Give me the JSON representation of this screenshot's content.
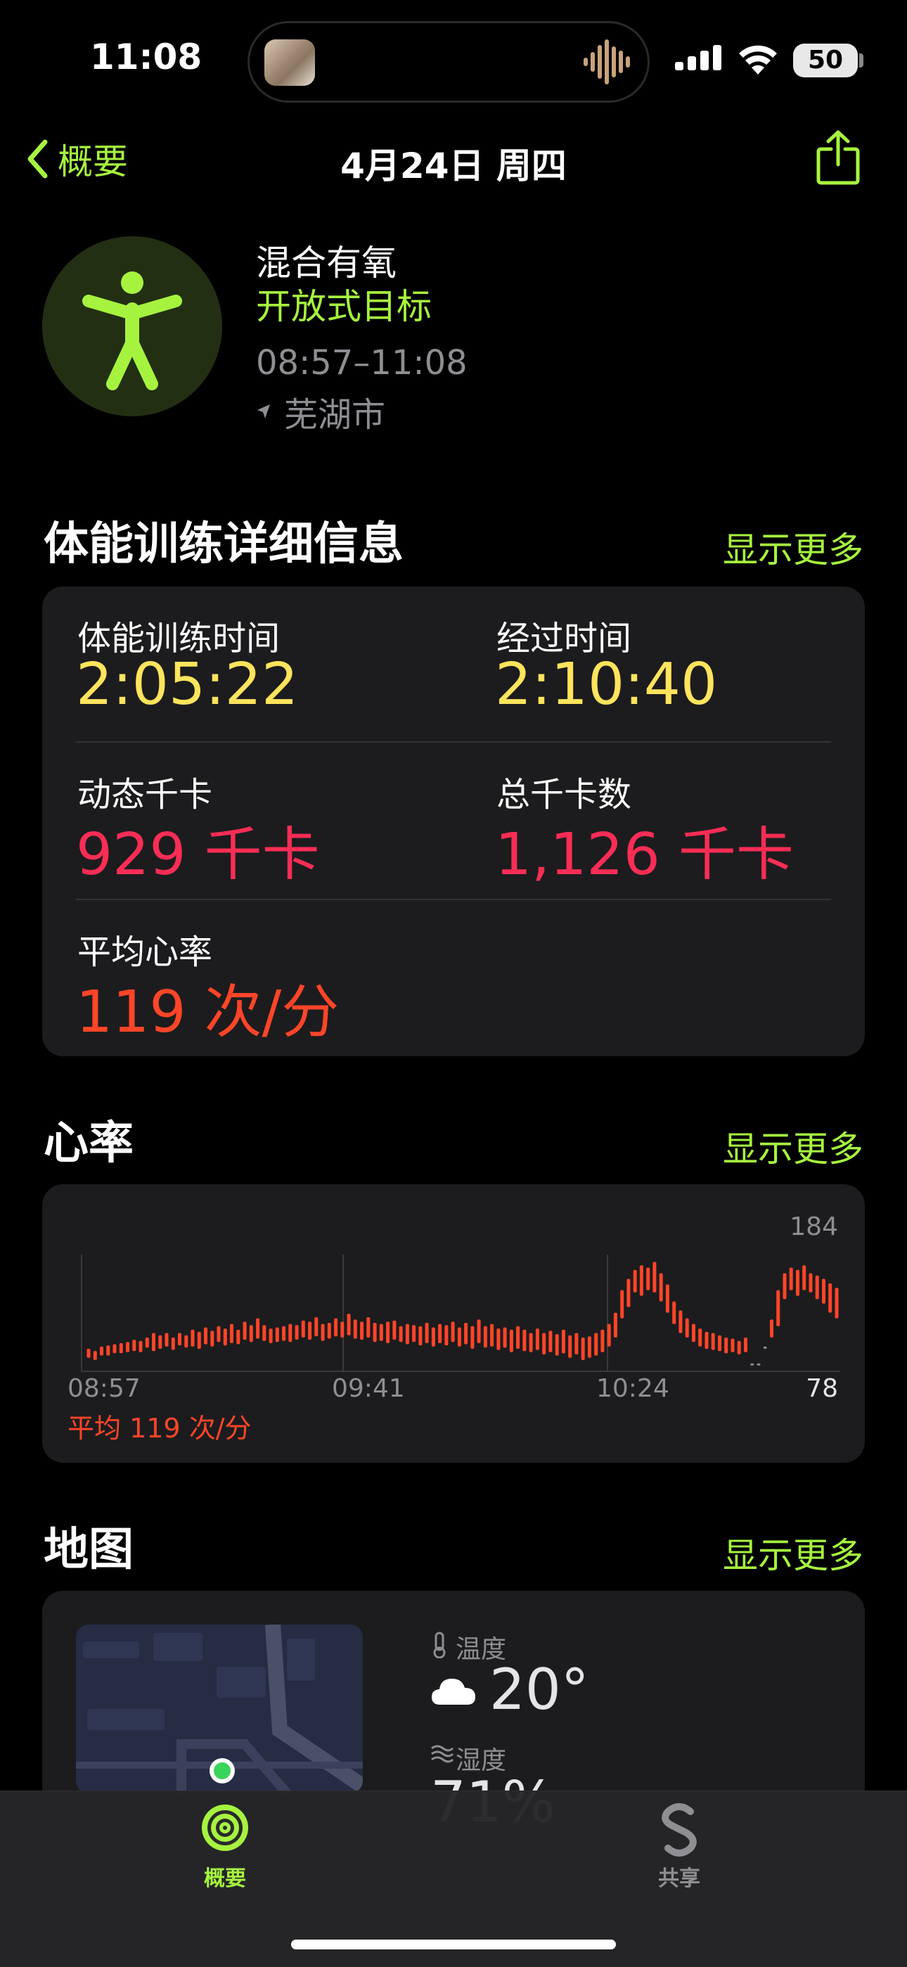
{
  "status_bar": {
    "time": "11:08",
    "battery": "50"
  },
  "nav": {
    "back_label": "概要",
    "title": "4月24日 周四"
  },
  "workout": {
    "type": "混合有氧",
    "goal": "开放式目标",
    "time_range": "08:57–11:08",
    "location": "芜湖市"
  },
  "details": {
    "title": "体能训练详细信息",
    "show_more": "显示更多",
    "workout_time": {
      "label": "体能训练时间",
      "value": "2:05:22"
    },
    "elapsed_time": {
      "label": "经过时间",
      "value": "2:10:40"
    },
    "active_kcal": {
      "label": "动态千卡",
      "value": "929",
      "unit": "千卡"
    },
    "total_kcal": {
      "label": "总千卡数",
      "value": "1,126",
      "unit": "千卡"
    },
    "avg_hr": {
      "label": "平均心率",
      "value": "119",
      "unit": "次/分"
    }
  },
  "heart_rate": {
    "title": "心率",
    "show_more": "显示更多",
    "max_label": "184",
    "min_label": "78",
    "x_labels": [
      "08:57",
      "09:41",
      "10:24"
    ],
    "average_text": "平均 119 次/分"
  },
  "chart_data": {
    "type": "bar",
    "color": "#ff4528",
    "ylim": [
      78,
      184
    ],
    "x_ticks": [
      "08:57",
      "09:41",
      "10:24"
    ],
    "series": [
      {
        "values": [
          [
            90,
            98
          ],
          [
            88,
            96
          ],
          [
            92,
            100
          ],
          [
            92,
            101
          ],
          [
            94,
            102
          ],
          [
            94,
            103
          ],
          [
            95,
            104
          ],
          [
            96,
            106
          ],
          [
            95,
            105
          ],
          [
            99,
            108
          ],
          [
            96,
            112
          ],
          [
            98,
            110
          ],
          [
            100,
            112
          ],
          [
            97,
            108
          ],
          [
            101,
            112
          ],
          [
            99,
            110
          ],
          [
            100,
            115
          ],
          [
            98,
            113
          ],
          [
            102,
            117
          ],
          [
            100,
            114
          ],
          [
            104,
            118
          ],
          [
            101,
            116
          ],
          [
            103,
            120
          ],
          [
            102,
            115
          ],
          [
            106,
            122
          ],
          [
            104,
            119
          ],
          [
            107,
            125
          ],
          [
            105,
            119
          ],
          [
            103,
            116
          ],
          [
            104,
            117
          ],
          [
            105,
            118
          ],
          [
            104,
            120
          ],
          [
            106,
            119
          ],
          [
            108,
            123
          ],
          [
            106,
            122
          ],
          [
            109,
            126
          ],
          [
            105,
            120
          ],
          [
            107,
            121
          ],
          [
            109,
            125
          ],
          [
            108,
            122
          ],
          [
            110,
            129
          ],
          [
            107,
            124
          ],
          [
            106,
            122
          ],
          [
            108,
            126
          ],
          [
            104,
            121
          ],
          [
            105,
            120
          ],
          [
            103,
            122
          ],
          [
            106,
            123
          ],
          [
            104,
            118
          ],
          [
            102,
            120
          ],
          [
            104,
            119
          ],
          [
            101,
            118
          ],
          [
            103,
            121
          ],
          [
            100,
            117
          ],
          [
            103,
            120
          ],
          [
            101,
            119
          ],
          [
            104,
            122
          ],
          [
            100,
            117
          ],
          [
            102,
            121
          ],
          [
            98,
            118
          ],
          [
            103,
            124
          ],
          [
            99,
            118
          ],
          [
            100,
            120
          ],
          [
            97,
            116
          ],
          [
            99,
            117
          ],
          [
            95,
            115
          ],
          [
            98,
            118
          ],
          [
            96,
            115
          ],
          [
            95,
            112
          ],
          [
            97,
            116
          ],
          [
            93,
            112
          ],
          [
            95,
            114
          ],
          [
            92,
            111
          ],
          [
            94,
            115
          ],
          [
            90,
            110
          ],
          [
            93,
            112
          ],
          [
            88,
            108
          ],
          [
            90,
            109
          ],
          [
            92,
            112
          ],
          [
            95,
            115
          ],
          [
            100,
            120
          ],
          [
            108,
            130
          ],
          [
            125,
            150
          ],
          [
            135,
            160
          ],
          [
            148,
            168
          ],
          [
            145,
            172
          ],
          [
            150,
            170
          ],
          [
            148,
            175
          ],
          [
            140,
            165
          ],
          [
            130,
            155
          ],
          [
            120,
            140
          ],
          [
            112,
            132
          ],
          [
            108,
            125
          ],
          [
            104,
            120
          ],
          [
            100,
            116
          ],
          [
            98,
            113
          ],
          [
            97,
            112
          ],
          [
            96,
            110
          ],
          [
            94,
            108
          ],
          [
            95,
            107
          ],
          [
            93,
            105
          ],
          [
            95,
            108
          ],
          [
            84,
            85
          ],
          [
            84,
            85
          ],
          [
            98,
            100
          ],
          [
            108,
            124
          ],
          [
            118,
            150
          ],
          [
            142,
            165
          ],
          [
            150,
            170
          ],
          [
            145,
            168
          ],
          [
            150,
            172
          ],
          [
            148,
            165
          ],
          [
            142,
            163
          ],
          [
            138,
            160
          ],
          [
            130,
            156
          ],
          [
            125,
            152
          ]
        ]
      }
    ]
  },
  "map": {
    "title": "地图",
    "show_more": "显示更多",
    "temperature_label": "温度",
    "temperature_value": "20°",
    "humidity_label": "湿度",
    "humidity_value": "71%"
  },
  "tabs": [
    {
      "label": "概要",
      "active": true
    },
    {
      "label": "共享",
      "active": false
    }
  ],
  "colors": {
    "accent_green": "#a6f33f",
    "yellow": "#ffe45c",
    "red": "#fa2d55",
    "orange": "#ff4528"
  }
}
